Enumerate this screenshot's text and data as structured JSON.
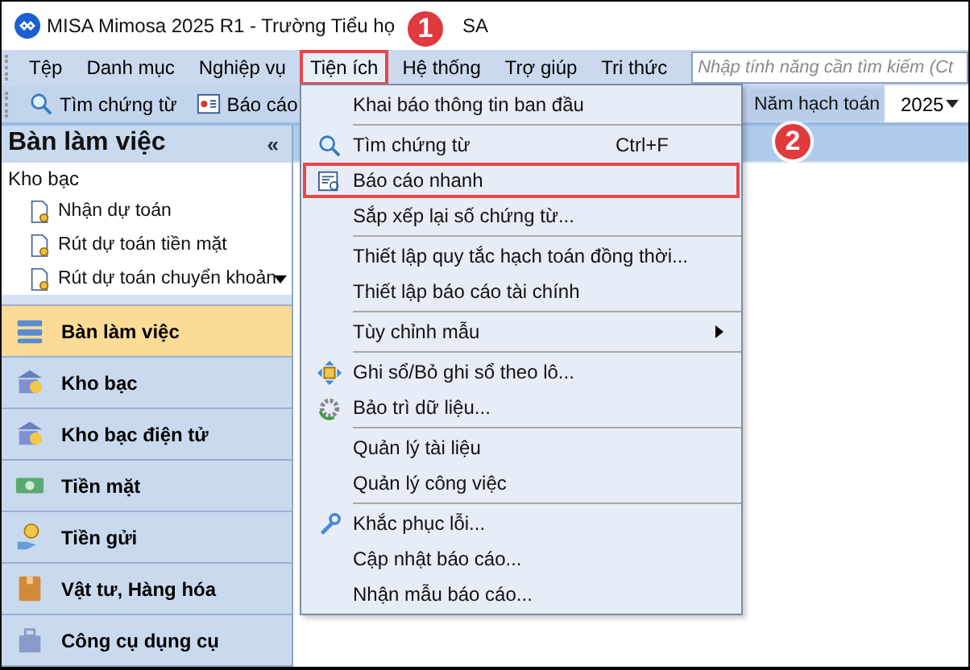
{
  "window": {
    "title_parts": [
      "MISA Mimosa 2025 R1 - Trường Tiểu họ",
      "SA"
    ]
  },
  "menu_bar": {
    "items": [
      {
        "label": "Tệp",
        "selected": false
      },
      {
        "label": "Danh mục",
        "selected": false
      },
      {
        "label": "Nghiệp vụ",
        "selected": false
      },
      {
        "label": "Tiện ích",
        "selected": true
      },
      {
        "label": "Hệ thống",
        "selected": false
      },
      {
        "label": "Trợ giúp",
        "selected": false
      },
      {
        "label": "Tri thức",
        "selected": false
      }
    ],
    "search": {
      "placeholder": "Nhập tính năng cần tìm kiếm (Ct"
    }
  },
  "toolbar": {
    "buttons": [
      "Tìm chứng từ",
      "Báo cáo"
    ],
    "year_label": "Năm hạch toán",
    "year_value": "2025"
  },
  "sidebar": {
    "title": "Bàn làm việc",
    "collapse": "«",
    "section": "Kho bạc",
    "items": [
      "Nhận dự toán",
      "Rút dự toán tiền mặt",
      "Rút dự toán chuyển khoản"
    ],
    "nav": [
      {
        "label": "Bàn làm việc",
        "selected": true
      },
      {
        "label": "Kho bạc",
        "selected": false
      },
      {
        "label": "Kho bạc điện tử",
        "selected": false
      },
      {
        "label": "Tiền mặt",
        "selected": false
      },
      {
        "label": "Tiền gửi",
        "selected": false
      },
      {
        "label": "Vật tư, Hàng hóa",
        "selected": false
      },
      {
        "label": "Công cụ dụng cụ",
        "selected": false
      }
    ]
  },
  "dropdown": {
    "items": [
      {
        "label": "Khai báo thông tin ban đầu",
        "separator_before": false,
        "selected": false
      },
      {
        "label": "Tìm chứng từ",
        "shortcut": "Ctrl+F",
        "separator_before": true,
        "selected": false
      },
      {
        "label": "Báo cáo nhanh",
        "separator_before": false,
        "selected": true
      },
      {
        "label": "Sắp xếp lại số chứng từ...",
        "separator_before": false,
        "selected": false
      },
      {
        "label": "Thiết lập quy tắc hạch toán đồng thời...",
        "separator_before": true,
        "selected": false
      },
      {
        "label": "Thiết lập báo cáo tài chính",
        "separator_before": false,
        "selected": false
      },
      {
        "label": "Tùy chỉnh mẫu",
        "submenu": true,
        "separator_before": true,
        "selected": false
      },
      {
        "label": "Ghi sổ/Bỏ ghi sổ theo lô...",
        "separator_before": true,
        "selected": false
      },
      {
        "label": "Bảo trì dữ liệu...",
        "separator_before": false,
        "selected": false
      },
      {
        "label": "Quản lý tài liệu",
        "separator_before": true,
        "selected": false
      },
      {
        "label": "Quản lý công việc",
        "separator_before": false,
        "selected": false
      },
      {
        "label": "Khắc phục lỗi...",
        "separator_before": true,
        "selected": false
      },
      {
        "label": "Cập nhật báo cáo...",
        "separator_before": false,
        "selected": false
      },
      {
        "label": "Nhận mẫu báo cáo...",
        "separator_before": false,
        "selected": false
      }
    ]
  },
  "callouts": [
    "1",
    "2"
  ]
}
